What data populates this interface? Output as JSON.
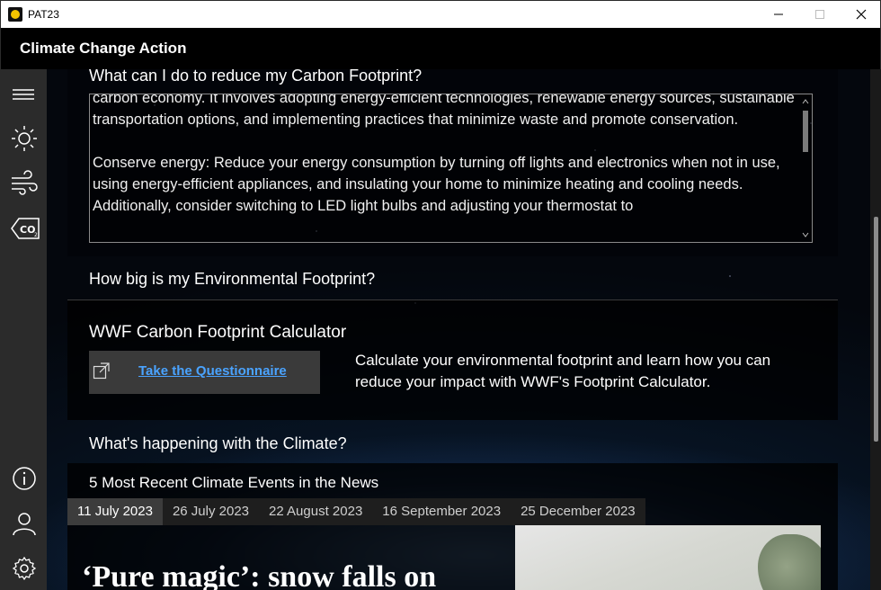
{
  "window": {
    "title": "PAT23",
    "icon": "sun-app-icon",
    "buttons": [
      "minimize",
      "maximize",
      "close"
    ]
  },
  "app": {
    "title": "Climate Change Action"
  },
  "nav": {
    "top_items": [
      "menu-icon",
      "sun-icon",
      "wind-icon",
      "co2-icon"
    ],
    "bottom_items": [
      "info-icon",
      "user-icon",
      "settings-icon"
    ]
  },
  "carbon": {
    "heading": "What can I do to reduce my Carbon Footprint?",
    "paragraph1": "carbon economy. It involves adopting energy-efficient technologies, renewable energy sources, sustainable transportation options, and implementing practices that minimize waste and promote conservation.",
    "paragraph2": "Conserve energy: Reduce your energy consumption by turning off lights and electronics when not in use, using energy-efficient appliances, and insulating your home to minimize heating and cooling needs. Additionally, consider switching to LED light bulbs and adjusting your thermostat to"
  },
  "environment": {
    "heading": "How big is my Environmental Footprint?",
    "card_title": "WWF Carbon Footprint Calculator",
    "link_label": "Take the Questionnaire",
    "description": "Calculate your environmental footprint and learn how you can reduce your impact with WWF's Footprint Calculator."
  },
  "climate": {
    "heading": "What's happening with the Climate?",
    "news_title": "5 Most Recent Climate Events in the News",
    "tabs": [
      "11 July 2023",
      "26 July 2023",
      "22 August 2023",
      "16 September 2023",
      "25 December 2023"
    ],
    "active_tab": "11 July 2023",
    "headline": "‘Pure magic’: snow falls on"
  },
  "colors": {
    "link": "#4aa3ff",
    "nav_bg": "#2b2b2b",
    "header_bg": "#000000"
  }
}
